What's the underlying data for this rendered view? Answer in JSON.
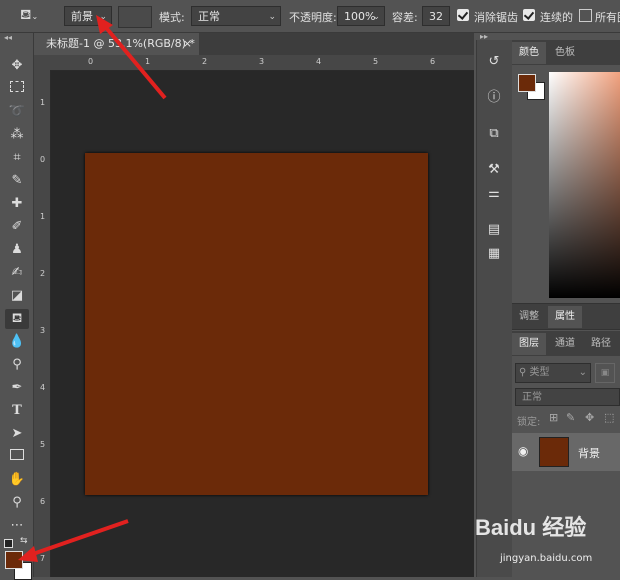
{
  "options": {
    "preset_label": "前景",
    "mode_label": "模式:",
    "mode_value": "正常",
    "opacity_label": "不透明度:",
    "opacity_value": "100%",
    "tolerance_label": "容差:",
    "tolerance_value": "32",
    "antialias_label": "消除锯齿",
    "contiguous_label": "连续的",
    "all_layers_label": "所有图"
  },
  "document": {
    "tab_title": "未标题-1 @ 53.1%(RGB/8) *",
    "close_glyph": "×",
    "ruler_h": [
      "0",
      "1",
      "2",
      "3",
      "4",
      "5",
      "6"
    ],
    "ruler_v": [
      "1",
      "0",
      "1",
      "2",
      "3",
      "4",
      "5",
      "6",
      "7"
    ],
    "fill_color": "#6b2a09"
  },
  "colors": {
    "foreground": "#6b2a09",
    "background": "#ffffff"
  },
  "panels": {
    "color_tab": "颜色",
    "swatches_tab": "色板",
    "adjust_tab": "调整",
    "properties_tab": "属性",
    "layers_tab": "图层",
    "channels_tab": "通道",
    "paths_tab": "路径",
    "kind_filter": "类型",
    "blend_mode": "正常",
    "lock_label": "锁定:",
    "layer_name": "背景"
  },
  "watermark": {
    "brand_text": "Baidu 经验",
    "url": "jingyan.baidu.com"
  }
}
